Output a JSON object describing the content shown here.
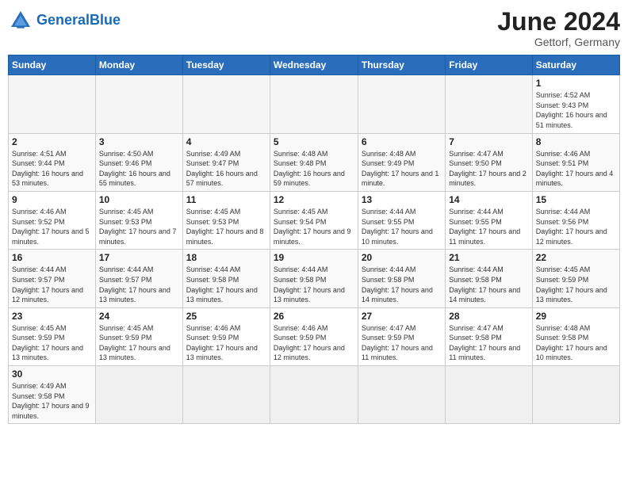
{
  "header": {
    "logo_general": "General",
    "logo_blue": "Blue",
    "month": "June 2024",
    "location": "Gettorf, Germany"
  },
  "weekdays": [
    "Sunday",
    "Monday",
    "Tuesday",
    "Wednesday",
    "Thursday",
    "Friday",
    "Saturday"
  ],
  "weeks": [
    {
      "days": [
        {
          "num": "",
          "empty": true
        },
        {
          "num": "",
          "empty": true
        },
        {
          "num": "",
          "empty": true
        },
        {
          "num": "",
          "empty": true
        },
        {
          "num": "",
          "empty": true
        },
        {
          "num": "",
          "empty": true
        },
        {
          "num": "1",
          "sunrise": "4:52 AM",
          "sunset": "9:43 PM",
          "daylight": "16 hours and 51 minutes."
        }
      ]
    },
    {
      "days": [
        {
          "num": "2",
          "sunrise": "4:51 AM",
          "sunset": "9:44 PM",
          "daylight": "16 hours and 53 minutes."
        },
        {
          "num": "3",
          "sunrise": "4:50 AM",
          "sunset": "9:46 PM",
          "daylight": "16 hours and 55 minutes."
        },
        {
          "num": "4",
          "sunrise": "4:49 AM",
          "sunset": "9:47 PM",
          "daylight": "16 hours and 57 minutes."
        },
        {
          "num": "5",
          "sunrise": "4:48 AM",
          "sunset": "9:48 PM",
          "daylight": "16 hours and 59 minutes."
        },
        {
          "num": "6",
          "sunrise": "4:48 AM",
          "sunset": "9:49 PM",
          "daylight": "17 hours and 1 minute."
        },
        {
          "num": "7",
          "sunrise": "4:47 AM",
          "sunset": "9:50 PM",
          "daylight": "17 hours and 2 minutes."
        },
        {
          "num": "8",
          "sunrise": "4:46 AM",
          "sunset": "9:51 PM",
          "daylight": "17 hours and 4 minutes."
        }
      ]
    },
    {
      "days": [
        {
          "num": "9",
          "sunrise": "4:46 AM",
          "sunset": "9:52 PM",
          "daylight": "17 hours and 5 minutes."
        },
        {
          "num": "10",
          "sunrise": "4:45 AM",
          "sunset": "9:53 PM",
          "daylight": "17 hours and 7 minutes."
        },
        {
          "num": "11",
          "sunrise": "4:45 AM",
          "sunset": "9:53 PM",
          "daylight": "17 hours and 8 minutes."
        },
        {
          "num": "12",
          "sunrise": "4:45 AM",
          "sunset": "9:54 PM",
          "daylight": "17 hours and 9 minutes."
        },
        {
          "num": "13",
          "sunrise": "4:44 AM",
          "sunset": "9:55 PM",
          "daylight": "17 hours and 10 minutes."
        },
        {
          "num": "14",
          "sunrise": "4:44 AM",
          "sunset": "9:55 PM",
          "daylight": "17 hours and 11 minutes."
        },
        {
          "num": "15",
          "sunrise": "4:44 AM",
          "sunset": "9:56 PM",
          "daylight": "17 hours and 12 minutes."
        }
      ]
    },
    {
      "days": [
        {
          "num": "16",
          "sunrise": "4:44 AM",
          "sunset": "9:57 PM",
          "daylight": "17 hours and 12 minutes."
        },
        {
          "num": "17",
          "sunrise": "4:44 AM",
          "sunset": "9:57 PM",
          "daylight": "17 hours and 13 minutes."
        },
        {
          "num": "18",
          "sunrise": "4:44 AM",
          "sunset": "9:58 PM",
          "daylight": "17 hours and 13 minutes."
        },
        {
          "num": "19",
          "sunrise": "4:44 AM",
          "sunset": "9:58 PM",
          "daylight": "17 hours and 13 minutes."
        },
        {
          "num": "20",
          "sunrise": "4:44 AM",
          "sunset": "9:58 PM",
          "daylight": "17 hours and 14 minutes."
        },
        {
          "num": "21",
          "sunrise": "4:44 AM",
          "sunset": "9:58 PM",
          "daylight": "17 hours and 14 minutes."
        },
        {
          "num": "22",
          "sunrise": "4:45 AM",
          "sunset": "9:59 PM",
          "daylight": "17 hours and 13 minutes."
        }
      ]
    },
    {
      "days": [
        {
          "num": "23",
          "sunrise": "4:45 AM",
          "sunset": "9:59 PM",
          "daylight": "17 hours and 13 minutes."
        },
        {
          "num": "24",
          "sunrise": "4:45 AM",
          "sunset": "9:59 PM",
          "daylight": "17 hours and 13 minutes."
        },
        {
          "num": "25",
          "sunrise": "4:46 AM",
          "sunset": "9:59 PM",
          "daylight": "17 hours and 13 minutes."
        },
        {
          "num": "26",
          "sunrise": "4:46 AM",
          "sunset": "9:59 PM",
          "daylight": "17 hours and 12 minutes."
        },
        {
          "num": "27",
          "sunrise": "4:47 AM",
          "sunset": "9:59 PM",
          "daylight": "17 hours and 11 minutes."
        },
        {
          "num": "28",
          "sunrise": "4:47 AM",
          "sunset": "9:58 PM",
          "daylight": "17 hours and 11 minutes."
        },
        {
          "num": "29",
          "sunrise": "4:48 AM",
          "sunset": "9:58 PM",
          "daylight": "17 hours and 10 minutes."
        }
      ]
    },
    {
      "days": [
        {
          "num": "30",
          "sunrise": "4:49 AM",
          "sunset": "9:58 PM",
          "daylight": "17 hours and 9 minutes."
        },
        {
          "num": "",
          "empty": true
        },
        {
          "num": "",
          "empty": true
        },
        {
          "num": "",
          "empty": true
        },
        {
          "num": "",
          "empty": true
        },
        {
          "num": "",
          "empty": true
        },
        {
          "num": "",
          "empty": true
        }
      ]
    }
  ]
}
